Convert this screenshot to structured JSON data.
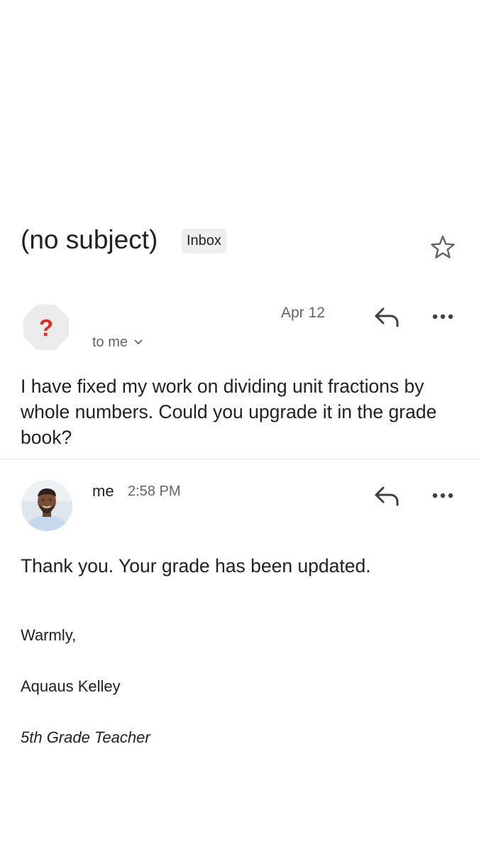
{
  "thread": {
    "subject": "(no subject)",
    "label": "Inbox"
  },
  "messages": [
    {
      "date": "Apr 12",
      "recipient": "to me",
      "avatar_glyph": "?",
      "body": "I have fixed my work on dividing unit fractions by whole numbers. Could you upgrade it in the grade book?"
    },
    {
      "sender": "me",
      "time": "2:58 PM",
      "body": "Thank you. Your grade has been updated.",
      "signature": {
        "closing": "Warmly,",
        "name": "Aquaus Kelley",
        "title": "5th Grade Teacher"
      }
    }
  ],
  "icons": {
    "star": "star-outline-icon",
    "reply": "reply-arrow-icon",
    "more": "more-horizontal-icon",
    "expand": "chevron-down-icon"
  },
  "colors": {
    "unknown_avatar_bg": "#ececec",
    "unknown_avatar_glyph": "#d93025",
    "secondary_text": "#5f6368",
    "label_chip_bg": "#eeeeee"
  }
}
